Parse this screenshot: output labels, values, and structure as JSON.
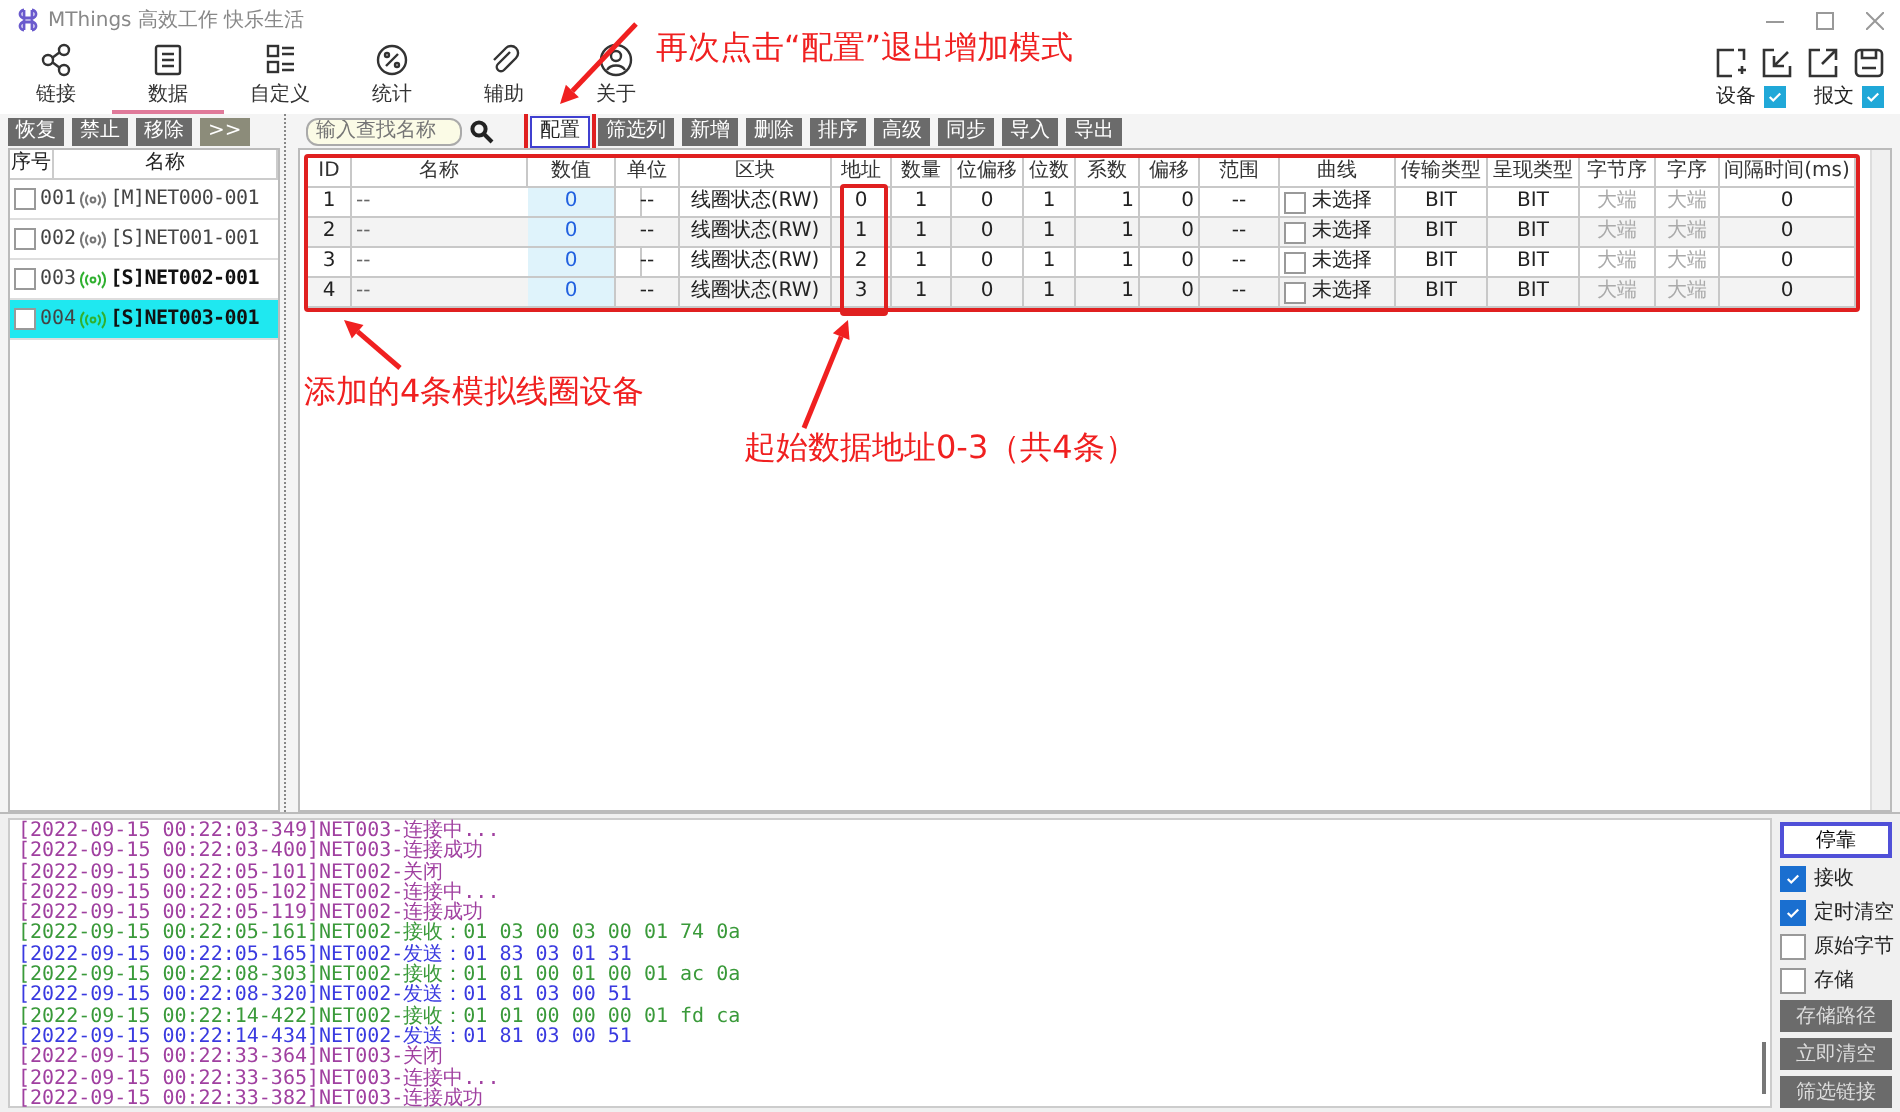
{
  "window": {
    "title": "MThings 高效工作 快乐生活"
  },
  "nav": [
    {
      "label": "链接",
      "selected": false
    },
    {
      "label": "数据",
      "selected": true
    },
    {
      "label": "自定义",
      "selected": false
    },
    {
      "label": "统计",
      "selected": false
    },
    {
      "label": "辅助",
      "selected": false
    },
    {
      "label": "关于",
      "selected": false
    }
  ],
  "display_options": [
    {
      "label": "设备",
      "checked": true
    },
    {
      "label": "报文",
      "checked": true
    }
  ],
  "device_toolbar": [
    "恢复",
    "禁止",
    "移除",
    ">>"
  ],
  "device_list": {
    "columns": [
      "序号",
      "名称"
    ],
    "items": [
      {
        "number": "001",
        "name": "[M]NET000-001",
        "checked": false,
        "connected": false,
        "selected": false
      },
      {
        "number": "002",
        "name": "[S]NET001-001",
        "checked": false,
        "connected": false,
        "selected": false
      },
      {
        "number": "003",
        "name": "[S]NET002-001",
        "checked": false,
        "connected": true,
        "selected": false
      },
      {
        "number": "004",
        "name": "[S]NET003-001",
        "checked": false,
        "connected": true,
        "selected": true
      }
    ]
  },
  "search": {
    "placeholder": "输入查找名称"
  },
  "data_toolbar": [
    {
      "label": "配置",
      "selected": true
    },
    {
      "label": "筛选列",
      "selected": false
    },
    {
      "label": "新增",
      "selected": false
    },
    {
      "label": "删除",
      "selected": false
    },
    {
      "label": "排序",
      "selected": false
    },
    {
      "label": "高级",
      "selected": false
    },
    {
      "label": "同步",
      "selected": false
    },
    {
      "label": "导入",
      "selected": false
    },
    {
      "label": "导出",
      "selected": false
    }
  ],
  "table": {
    "columns": [
      {
        "label": "ID",
        "kind": "center"
      },
      {
        "label": "名称",
        "kind": "left"
      },
      {
        "label": "数值",
        "kind": "value"
      },
      {
        "label": "单位",
        "kind": "center"
      },
      {
        "label": "区块",
        "kind": "center"
      },
      {
        "label": "地址",
        "kind": "address"
      },
      {
        "label": "数量",
        "kind": "center"
      },
      {
        "label": "位偏移",
        "kind": "center"
      },
      {
        "label": "位数",
        "kind": "center"
      },
      {
        "label": "系数",
        "kind": "right"
      },
      {
        "label": "偏移",
        "kind": "right"
      },
      {
        "label": "范围",
        "kind": "center"
      },
      {
        "label": "曲线",
        "kind": "check"
      },
      {
        "label": "传输类型",
        "kind": "center"
      },
      {
        "label": "呈现类型",
        "kind": "center"
      },
      {
        "label": "字节序",
        "kind": "muted"
      },
      {
        "label": "字序",
        "kind": "muted"
      },
      {
        "label": "间隔时间(ms)",
        "kind": "center"
      }
    ],
    "rows": [
      {
        "curve_checked": false,
        "cells": [
          "1",
          "--",
          "0",
          "--",
          "线圈状态(RW)",
          "0",
          "1",
          "0",
          "1",
          "1",
          "0",
          "--",
          "未选择",
          "BIT",
          "BIT",
          "大端",
          "大端",
          "0"
        ]
      },
      {
        "curve_checked": false,
        "cells": [
          "2",
          "--",
          "0",
          "--",
          "线圈状态(RW)",
          "1",
          "1",
          "0",
          "1",
          "1",
          "0",
          "--",
          "未选择",
          "BIT",
          "BIT",
          "大端",
          "大端",
          "0"
        ]
      },
      {
        "curve_checked": false,
        "cells": [
          "3",
          "--",
          "0",
          "--",
          "线圈状态(RW)",
          "2",
          "1",
          "0",
          "1",
          "1",
          "0",
          "--",
          "未选择",
          "BIT",
          "BIT",
          "大端",
          "大端",
          "0"
        ]
      },
      {
        "curve_checked": false,
        "cells": [
          "4",
          "--",
          "0",
          "--",
          "线圈状态(RW)",
          "3",
          "1",
          "0",
          "1",
          "1",
          "0",
          "--",
          "未选择",
          "BIT",
          "BIT",
          "大端",
          "大端",
          "0"
        ]
      }
    ]
  },
  "annotations": [
    {
      "kind": "config",
      "text": "再次点击“配置”退出增加模式"
    },
    {
      "kind": "rows",
      "text": "添加的4条模拟线圈设备"
    },
    {
      "kind": "address",
      "text": "起始数据地址0-3（共4条）"
    }
  ],
  "log": [
    {
      "kind": "status",
      "text": "[2022-09-15 00:22:03-349]NET003-连接中..."
    },
    {
      "kind": "status",
      "text": "[2022-09-15 00:22:03-400]NET003-连接成功"
    },
    {
      "kind": "status",
      "text": "[2022-09-15 00:22:05-101]NET002-关闭"
    },
    {
      "kind": "status",
      "text": "[2022-09-15 00:22:05-102]NET002-连接中..."
    },
    {
      "kind": "status",
      "text": "[2022-09-15 00:22:05-119]NET002-连接成功"
    },
    {
      "kind": "receive",
      "text": "[2022-09-15 00:22:05-161]NET002-接收：01 03 00 03 00 01 74 0a"
    },
    {
      "kind": "send",
      "text": "[2022-09-15 00:22:05-165]NET002-发送：01 83 03 01 31"
    },
    {
      "kind": "receive",
      "text": "[2022-09-15 00:22:08-303]NET002-接收：01 01 00 01 00 01 ac 0a"
    },
    {
      "kind": "send",
      "text": "[2022-09-15 00:22:08-320]NET002-发送：01 81 03 00 51"
    },
    {
      "kind": "receive",
      "text": "[2022-09-15 00:22:14-422]NET002-接收：01 01 00 00 00 01 fd ca"
    },
    {
      "kind": "send",
      "text": "[2022-09-15 00:22:14-434]NET002-发送：01 81 03 00 51"
    },
    {
      "kind": "status",
      "text": "[2022-09-15 00:22:33-364]NET003-关闭"
    },
    {
      "kind": "status",
      "text": "[2022-09-15 00:22:33-365]NET003-连接中..."
    },
    {
      "kind": "status",
      "text": "[2022-09-15 00:22:33-382]NET003-连接成功"
    }
  ],
  "log_controls": {
    "dock_button": "停靠",
    "options": [
      {
        "label": "接收",
        "checked": true
      },
      {
        "label": "定时清空",
        "checked": true
      },
      {
        "label": "原始字节",
        "checked": false
      },
      {
        "label": "存储",
        "checked": false
      }
    ],
    "buttons": [
      "存储路径",
      "立即清空",
      "筛选链接"
    ]
  }
}
